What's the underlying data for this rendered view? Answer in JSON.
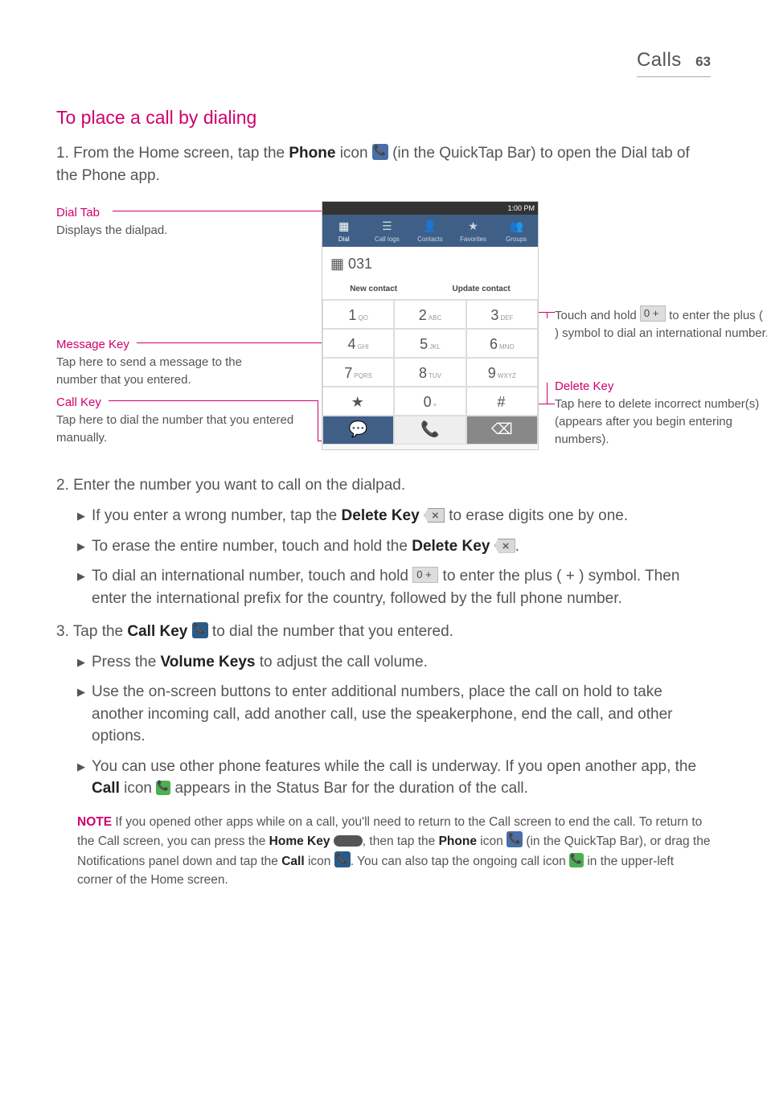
{
  "header": {
    "section": "Calls",
    "page": "63"
  },
  "h2": "To place a call by dialing",
  "step1_prefix": "1.  From the Home screen, tap the ",
  "step1_phone": "Phone",
  "step1_mid": " icon ",
  "step1_suffix": " (in the QuickTap Bar) to open the Dial tab of the Phone app.",
  "callouts": {
    "dial_tab_title": "Dial Tab",
    "dial_tab_body": "Displays the dialpad.",
    "msg_title": "Message Key",
    "msg_body": "Tap here to send a message to the number that you entered.",
    "call_title": "Call Key",
    "call_body": "Tap here to dial the number that you entered manually.",
    "zero_body1": "Touch and hold ",
    "zero_body2": " to enter the plus ( + ) symbol to dial an international number.",
    "del_title": "Delete Key",
    "del_body": "Tap here to delete incorrect number(s) (appears after you begin entering numbers)."
  },
  "shot": {
    "time": "1:00 PM",
    "tabs": [
      "Dial",
      "Call logs",
      "Contacts",
      "Favorites",
      "Groups"
    ],
    "number": "031",
    "new_contact": "New contact",
    "update_contact": "Update contact",
    "keys": [
      [
        "1",
        "QO",
        "2",
        "ABC",
        "3",
        "DEF"
      ],
      [
        "4",
        "GHI",
        "5",
        "JKL",
        "6",
        "MNO"
      ],
      [
        "7",
        "PQRS",
        "8",
        "TUV",
        "9",
        "WXYZ"
      ],
      [
        "★",
        "",
        "0",
        "+",
        "#",
        ""
      ]
    ]
  },
  "step2": "2.  Enter the number you want to call on the dialpad.",
  "b2_1a": "If you enter a wrong number, tap the ",
  "b2_1b": "Delete Key",
  "b2_1c": " to erase digits one by one.",
  "b2_2a": "To erase the entire number, touch and hold the ",
  "b2_2b": "Delete Key",
  "b2_2c": ".",
  "b2_3a": "To dial an international number, touch and hold ",
  "b2_3b": " to enter the plus ( + ) symbol. Then enter the international prefix for the country, followed by the full phone number.",
  "step3a": "3. Tap the ",
  "step3b": "Call Key",
  "step3c": " to dial the number that you entered.",
  "b3_1a": "Press the ",
  "b3_1b": "Volume Keys",
  "b3_1c": " to adjust the call volume.",
  "b3_2": "Use the on-screen buttons to enter additional numbers, place the call on hold to take another incoming call, add another call, use the speakerphone, end the call, and other options.",
  "b3_3a": "You can use other phone features while the call is underway. If you open another app, the ",
  "b3_3b": "Call",
  "b3_3c": " icon ",
  "b3_3d": " appears in the Status Bar for the duration of the call.",
  "note_label": "NOTE",
  "note_a": " If you opened other apps while on a call, you'll need to return to the Call screen to end the call. To return to the Call screen, you can press the ",
  "note_b": "Home Key",
  "note_c": ", then tap the ",
  "note_d": "Phone",
  "note_e": " icon ",
  "note_f": " (in the QuickTap Bar), or drag the Notifications panel down and tap the ",
  "note_g": "Call",
  "note_h": " icon ",
  "note_i": ". You can also tap the ongoing call icon ",
  "note_j": " in the upper-left corner of the Home screen."
}
